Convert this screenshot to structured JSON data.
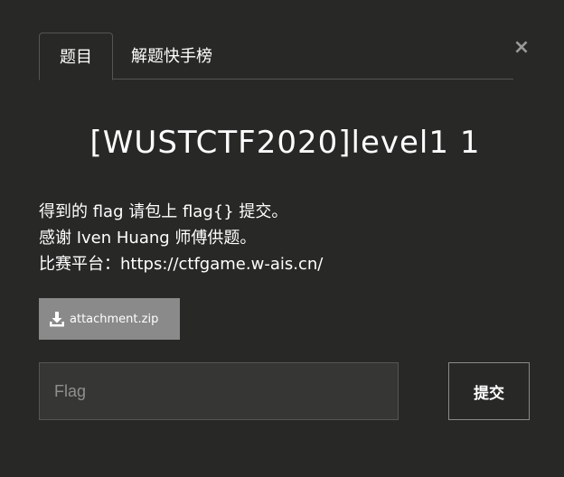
{
  "tabs": [
    {
      "label": "题目",
      "active": true
    },
    {
      "label": "解题快手榜",
      "active": false
    }
  ],
  "close_symbol": "×",
  "challenge": {
    "title": "[WUSTCTF2020]level1 1"
  },
  "description": {
    "line1": "得到的 flag 请包上 flag{} 提交。",
    "line2": "感谢 Iven Huang 师傅供题。",
    "line3": "比赛平台：https://ctfgame.w-ais.cn/"
  },
  "attachment": {
    "icon": "download-icon",
    "label": "attachment.zip"
  },
  "flag_form": {
    "placeholder": "Flag",
    "value": "",
    "submit_label": "提交"
  },
  "colors": {
    "background": "#282826",
    "attachment_button": "#8a8a8a",
    "text": "#ffffff"
  }
}
